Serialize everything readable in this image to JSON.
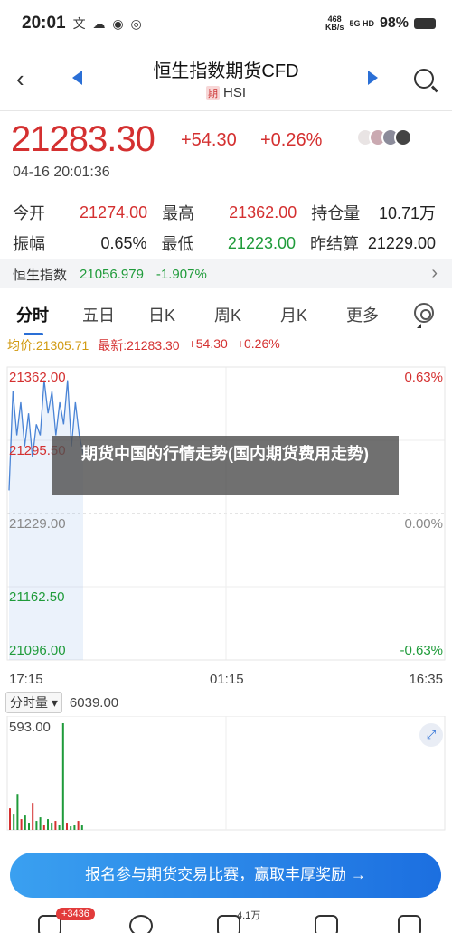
{
  "status_bar": {
    "time": "20:01",
    "icons": "文 ☁ ◉ ◎",
    "net_speed_value": "468",
    "net_speed_unit": "KB/s",
    "signal": "5G HD",
    "battery": "98%"
  },
  "header": {
    "title": "恒生指数期货CFD",
    "badge": "期",
    "code": "HSI"
  },
  "quote": {
    "price": "21283.30",
    "change": "+54.30",
    "change_pct": "+0.26%",
    "timestamp": "04-16 20:01:36"
  },
  "stats": [
    {
      "label": "今开",
      "value": "21274.00",
      "color": "red",
      "label2": "最高",
      "value2": "21362.00",
      "color2": "red",
      "label3": "持仓量",
      "value3": "10.71万"
    },
    {
      "label": "振幅",
      "value": "0.65%",
      "color": "black",
      "label2": "最低",
      "value2": "21223.00",
      "color2": "green",
      "label3": "昨结算",
      "value3": "21229.00"
    }
  ],
  "index_bar": {
    "name": "恒生指数",
    "value": "21056.979",
    "pct": "-1.907%"
  },
  "tabs": [
    "分时",
    "五日",
    "日K",
    "周K",
    "月K",
    "更多"
  ],
  "legend": {
    "avg": "均价:21305.71",
    "latest": "最新:21283.30",
    "change": "+54.30",
    "pct": "+0.26%"
  },
  "chart_data": {
    "type": "line",
    "y_labels_left": [
      "21362.00",
      "21295.50",
      "21229.00",
      "21162.50",
      "21096.00"
    ],
    "y_labels_right": [
      "0.63%",
      "",
      "0.00%",
      "",
      "-0.63%"
    ],
    "x_labels": [
      "17:15",
      "01:15",
      "16:35"
    ],
    "ylim": [
      21096.0,
      21362.0
    ],
    "reference": 21229.0,
    "series": [
      {
        "values": [
          21250,
          21340,
          21300,
          21330,
          21290,
          21320,
          21280,
          21310,
          21300,
          21350,
          21320,
          21340,
          21300,
          21330,
          21310,
          21350,
          21290,
          21330,
          21300,
          21283.3
        ]
      }
    ]
  },
  "volume": {
    "selector": "分时量",
    "value": "6039.00",
    "max_label": "593.00",
    "bars": [
      120,
      90,
      200,
      60,
      80,
      40,
      150,
      50,
      70,
      30,
      60,
      40,
      50,
      30,
      593,
      40,
      20,
      30,
      50,
      25
    ]
  },
  "overlay_text": "期货中国的行情走势(国内期货费用走势)",
  "cta": "报名参与期货交易比赛，赢取丰厚奖励 →",
  "bottom_nav": {
    "badge": "+3436",
    "count": "4.1万"
  }
}
